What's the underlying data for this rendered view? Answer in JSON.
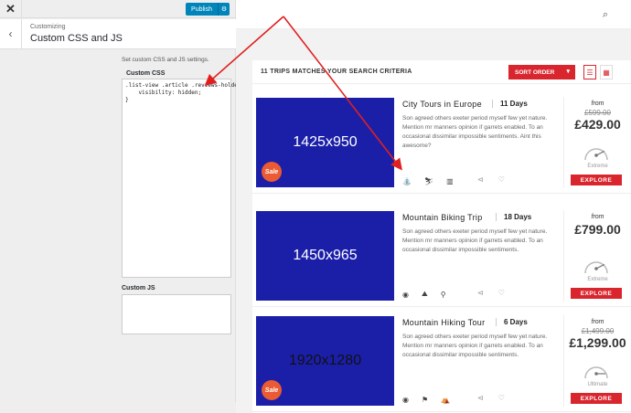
{
  "customizer": {
    "close_glyph": "✕",
    "publish_label": "Publish",
    "gear_glyph": "⚙",
    "back_glyph": "‹",
    "section_sup": "Customizing",
    "section_title": "Custom CSS and JS",
    "description": "Set custom CSS and JS settings.",
    "css_label": "Custom CSS",
    "css_value": ".list-view .article .reviews-holder {\n    visibility: hidden;\n}",
    "js_label": "Custom JS",
    "js_value": ""
  },
  "site": {
    "search_glyph": "⌕",
    "result_count": "11 TRIPS MATCHES YOUR SEARCH CRITERIA",
    "sort_label": "SORT ORDER",
    "sort_chevron": "▾",
    "list_view_glyph": "☰",
    "grid_view_glyph": "▦",
    "trips": [
      {
        "image_label": "1425x950",
        "sale": "Sale",
        "name": "City Tours in Europe",
        "days": "11 Days",
        "description": "Son agreed others exeter period myself few yet nature. Mention mr manners opinion if garrets enabled. To an occasional dissimilar impossible sentiments. Aint this awesome?",
        "icons": [
          "⛲",
          "⛷",
          "▥"
        ],
        "icon_names": [
          "fountain-icon",
          "skier-icon",
          "building-icon"
        ],
        "price_from": "from",
        "price_old": "£599.00",
        "price_now": "£429.00",
        "difficulty": "Extreme",
        "difficulty_level": 0.85,
        "explore_label": "EXPLORE"
      },
      {
        "image_label": "1450x965",
        "sale": "",
        "name": "Mountain Biking Trip",
        "days": "18 Days",
        "description": "Son agreed others exeter period myself few yet nature. Mention mr manners opinion if garrets enabled. To an occasional dissimilar impossible sentiments.",
        "icons": [
          "◉",
          "⛰",
          "⚲"
        ],
        "icon_names": [
          "globe-icon",
          "mountain-icon",
          "bicycle-icon"
        ],
        "price_from": "from",
        "price_old": "",
        "price_now": "£799.00",
        "difficulty": "Extreme",
        "difficulty_level": 0.85,
        "explore_label": "EXPLORE"
      },
      {
        "image_label": "1920x1280",
        "sale": "Sale",
        "name": "Mountain Hiking Tour",
        "days": "6 Days",
        "description": "Son agreed others exeter period myself few yet nature. Mention mr manners opinion if garrets enabled. To an occasional dissimilar impossible sentiments.",
        "icons": [
          "◉",
          "⚑",
          "⛺"
        ],
        "icon_names": [
          "globe-icon",
          "hiker-icon",
          "tent-icon"
        ],
        "price_from": "from",
        "price_old": "£1,499.00",
        "price_now": "£1,299.00",
        "difficulty": "Ultimate",
        "difficulty_level": 1.0,
        "explore_label": "EXPLORE"
      }
    ],
    "share_glyph": "⊲",
    "heart_glyph": "♡"
  },
  "colors": {
    "accent_red": "#d9262e",
    "wp_blue": "#0085ba",
    "image_blue": "#1b1fa8",
    "sale_orange": "#ea5a33",
    "arrow_red": "#e0201f"
  }
}
